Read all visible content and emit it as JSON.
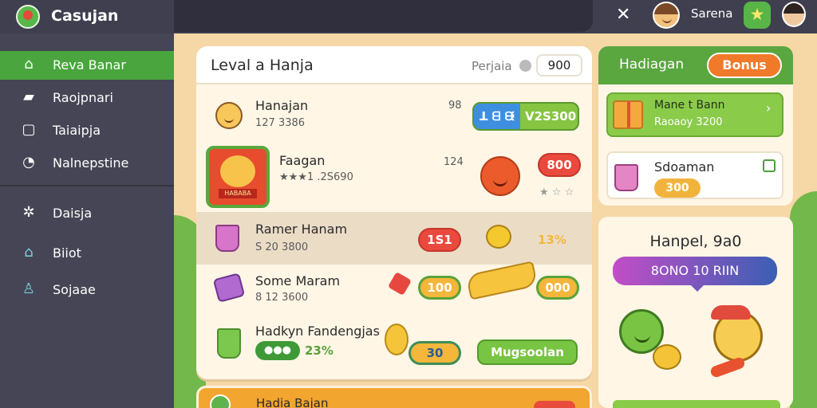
{
  "header": {
    "app_title": "Casujan",
    "close_label": "✕",
    "user_name": "Sarena",
    "badge_icon": "★"
  },
  "sidebar": {
    "items": [
      {
        "label": "Reva Banar",
        "icon": "home-icon",
        "glyph": "⌂",
        "active": true
      },
      {
        "label": "Raojpnari",
        "icon": "chat-icon",
        "glyph": "▰"
      },
      {
        "label": "Taiaipja",
        "icon": "window-icon",
        "glyph": "▢"
      },
      {
        "label": "Nalnepstine",
        "icon": "clock-icon",
        "glyph": "◔"
      },
      {
        "label": "Daisja",
        "icon": "settings-icon",
        "glyph": "✲"
      },
      {
        "label": "Biiot",
        "icon": "shop-icon",
        "glyph": "⌂"
      },
      {
        "label": "Sojaae",
        "icon": "person-icon",
        "glyph": "♙"
      }
    ]
  },
  "main": {
    "title": "Leval a Hanja",
    "points_label": "Perjaia",
    "points_value": "900",
    "rows": [
      {
        "name": "Hanajan",
        "sub": "127 3386",
        "right": "98",
        "btn_blue": "ꓕ ᗺ ᙠ",
        "btn_value": "V2S300"
      },
      {
        "name": "Faagan",
        "sub": "★★★1 .2S690",
        "right": "124",
        "btn_red": "800",
        "stars": "★ ☆ ☆"
      },
      {
        "name": "Ramer Hanam",
        "sub": "S 20 3800",
        "pill": "1S1",
        "pct": "13%"
      },
      {
        "name": "Some Maram",
        "sub": "8 12 3600",
        "pill": "100",
        "pill2": "000"
      },
      {
        "name": "Hadkyn Fandengjas",
        "dots": "●●●",
        "pct": "23%",
        "pill": "30",
        "btn": "Mugsoolan"
      }
    ],
    "tile_label": "HABABA",
    "bottom_label": "Hadia Bajan"
  },
  "right": {
    "card_title": "Hadiagan",
    "bonus_label": "Bonus",
    "gift_name": "Mane t Bann",
    "gift_sub": "Raoaoy 3200",
    "dom_name": "Sdoaman",
    "dom_value": "300",
    "promo_title": "Hanpel, 9a0",
    "promo_banner": "8ONO 10 RIIN"
  }
}
